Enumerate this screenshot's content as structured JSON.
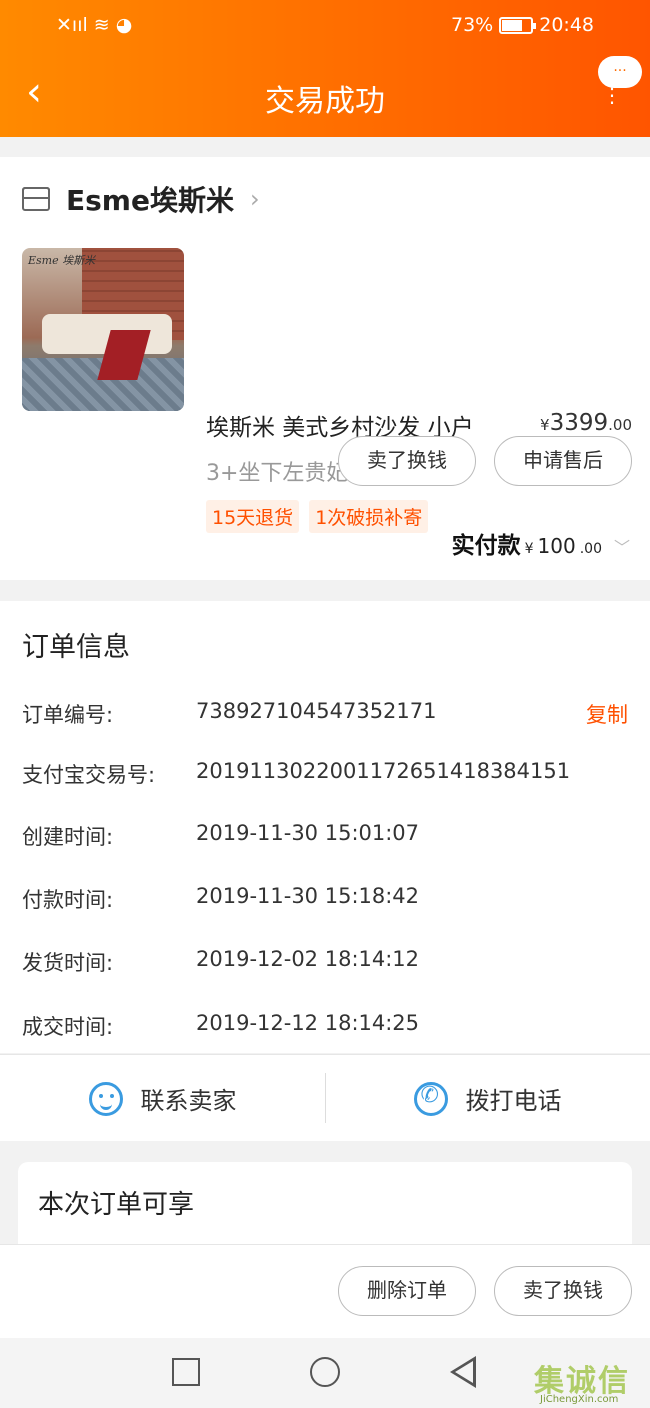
{
  "status_bar": {
    "battery": "73%",
    "battery_level": 0.73,
    "time": "20:48",
    "signal_icons": "✕ııl  ≋  ◕"
  },
  "header": {
    "title": "交易成功",
    "back": "‹",
    "more_bubble": "···",
    "more_dots": "⋮"
  },
  "shop": {
    "name": "Esme埃斯米",
    "chevron": "›"
  },
  "product": {
    "name": "埃斯米 美式乡村沙发 小户",
    "attrs": "3+坐下左贵妃;组合",
    "price_symbol": "¥",
    "price_int": "3399",
    "price_dec": ".00",
    "qty_prefix": "x",
    "qty": "1",
    "tags": [
      "15天退货",
      "1次破损补寄"
    ],
    "image_brand": "Esme 埃斯米"
  },
  "actions": {
    "sell": "卖了换钱",
    "after_sale": "申请售后"
  },
  "payment": {
    "label": "实付款",
    "symbol": "¥",
    "amount_int": "100",
    "amount_dec": ".00",
    "chevron": "﹀"
  },
  "order": {
    "title": "订单信息",
    "copy_label": "复制",
    "rows": [
      {
        "label": "订单编号:",
        "value": "738927104547352171"
      },
      {
        "label": "支付宝交易号:",
        "value": "2019113022001172651418384151"
      },
      {
        "label": "创建时间:",
        "value": "2019-11-30 15:01:07"
      },
      {
        "label": "付款时间:",
        "value": "2019-11-30 15:18:42"
      },
      {
        "label": "发货时间:",
        "value": "2019-12-02 18:14:12"
      },
      {
        "label": "成交时间:",
        "value": "2019-12-12 18:14:25"
      }
    ]
  },
  "contact": {
    "seller": "联系卖家",
    "call": "拨打电话"
  },
  "promo": {
    "title": "本次订单可享"
  },
  "bottom": {
    "delete": "删除订单",
    "sell": "卖了换钱"
  },
  "watermark": {
    "text": "集诚信",
    "sub": "JiChengXin.com"
  }
}
